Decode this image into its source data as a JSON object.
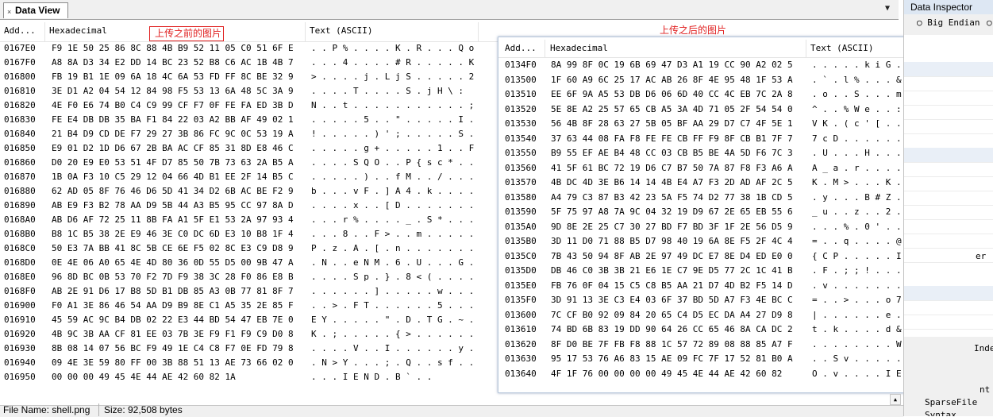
{
  "tab": {
    "label": "Data View",
    "close_glyph": "×"
  },
  "collapse_glyph": "▼",
  "columns": {
    "addr": "Add...",
    "hex": "Hexadecimal",
    "text": "Text (ASCII)"
  },
  "annotation_before": "上传之前的图片",
  "annotation_after": "上传之后的图片",
  "left_rows": [
    {
      "a": "0167E0",
      "h": "F9 1E 50 25 86 8C 88 4B B9 52 11 05 C0 51 6F E",
      "t": ". . P % . . . . K . R . . . Q o"
    },
    {
      "a": "0167F0",
      "h": "A8 8A D3 34 E2 DD 14 BC 23 52 B8 C6 AC 1B 4B 7",
      "t": ". . . 4 . . . . # R . . . . . K"
    },
    {
      "a": "016800",
      "h": "FB 19 B1 1E 09 6A 18 4C 6A 53 FD FF 8C BE 32 9",
      "t": "> . . . . j . L j S . . . . . 2"
    },
    {
      "a": "016810",
      "h": "3E D1 A2 04 54 12 84 98 F5 53 13 6A 48 5C 3A 9",
      "t": ". . . . T . . . . S . j H \\ :"
    },
    {
      "a": "016820",
      "h": "4E F0 E6 74 B0 C4 C9 99 CF F7 0F FE FA ED 3B D",
      "t": "N . . t . . . . . . . . . . . ;"
    },
    {
      "a": "016830",
      "h": "FE E4 DB DB 35 BA F1 84 22 03 A2 BB AF 49 02 1",
      "t": ". . . . . 5 . . \" . . . . . I ."
    },
    {
      "a": "016840",
      "h": "21 B4 D9 CD DE F7 29 27 3B 86 FC 9C 0C 53 19 A",
      "t": "! . . . . . ) ' ; . . . . . S ."
    },
    {
      "a": "016850",
      "h": "E9 01 D2 1D D6 67 2B BA AC CF 85 31 8D E8 46 C",
      "t": ". . . . . g + . . . . . 1 . . F"
    },
    {
      "a": "016860",
      "h": "D0 20 E9 E0 53 51 4F D7 85 50 7B 73 63 2A B5 A",
      "t": ". . . . S Q O . . P { s c * . ."
    },
    {
      "a": "016870",
      "h": "1B 0A F3 10 C5 29 12 04 66 4D B1 EE 2F 14 B5 C",
      "t": ". . . . . ) . . f M . . / . . ."
    },
    {
      "a": "016880",
      "h": "62 AD 05 8F 76 46 D6 5D 41 34 D2 6B AC BE F2 9",
      "t": "b . . . v F . ] A 4 . k . . . ."
    },
    {
      "a": "016890",
      "h": "AB E9 F3 B2 78 AA D9 5B 44 A3 B5 95 CC 97 8A D",
      "t": ". . . . x . . [ D . . . . . . ."
    },
    {
      "a": "0168A0",
      "h": "AB D6 AF 72 25 11 8B FA A1 5F E1 53 2A 97 93 4",
      "t": ". . . r % . . . . _ . S * . . ."
    },
    {
      "a": "0168B0",
      "h": "B8 1C B5 38 2E E9 46 3E C0 DC 6D E3 10 B8 1F 4",
      "t": ". . . 8 . . F > . . m . . . . ."
    },
    {
      "a": "0168C0",
      "h": "50 E3 7A BB 41 8C 5B CE 6E F5 02 8C E3 C9 D8 9",
      "t": "P . z . A . [ . n . . . . . . ."
    },
    {
      "a": "0168D0",
      "h": "0E 4E 06 A0 65 4E 4D 80 36 0D 55 D5 00 9B 47 A",
      "t": ". N . . e N M . 6 . U . . . G ."
    },
    {
      "a": "0168E0",
      "h": "96 8D BC 0B 53 70 F2 7D F9 38 3C 28 F0 86 E8 B",
      "t": ". . . . S p . } . 8 < ( . . . ."
    },
    {
      "a": "0168F0",
      "h": "AB 2E 91 D6 17 B8 5D B1 DB 85 A3 0B 77 81 8F 7",
      "t": ". . . . . . ] . . . . . w . . ."
    },
    {
      "a": "016900",
      "h": "F0 A1 3E 86 46 54 AA D9 B9 8E C1 A5 35 2E 85 F",
      "t": ". . > . F T . . . . . . 5 . . ."
    },
    {
      "a": "016910",
      "h": "45 59 AC 9C B4 DB 02 22 E3 44 BD 54 47 EB 7E 0",
      "t": "E Y . . . . . \" . D . T G . ~ ."
    },
    {
      "a": "016920",
      "h": "4B 9C 3B AA CF 81 EE 03 7B 3E F9 F1 F9 C9 D0 8",
      "t": "K . ; . . . . . { > . . . . . ."
    },
    {
      "a": "016930",
      "h": "8B 08 14 07 56 BC F9 49 1E C4 C8 F7 0E FD 79 8",
      "t": ". . . . V . . I . . . . . . y ."
    },
    {
      "a": "016940",
      "h": "09 4E 3E 59 80 FF 00 3B 88 51 13 AE 73 66 02 0",
      "t": ". N > Y . . . ; . Q . . s f . ."
    },
    {
      "a": "016950",
      "h": "00 00 00 49 45 4E 44 AE 42 60 82 1A",
      "t": ". . . I E N D . B ` . ."
    }
  ],
  "right_rows": [
    {
      "a": "0134F0",
      "h": "8A 99 8F 0C 19 6B 69 47 D3 A1 19 CC 90 A2 02 5",
      "t": ". . . . . k i G . . . . . . . ."
    },
    {
      "a": "013500",
      "h": "1F 60 A9 6C 25 17 AC AB 26 8F 4E 95 48 1F 53 A",
      "t": ". ` . l % . . . & . N . H . S ."
    },
    {
      "a": "013510",
      "h": "EE 6F 9A A5 53 DB D6 06 6D 40 CC 4C EB 7C 2A 8",
      "t": ". o . . S . . . m @ . L . | * ."
    },
    {
      "a": "013520",
      "h": "5E 8E A2 25 57 65 CB A5 3A 4D 71 05 2F 54 54 0",
      "t": "^ . . % W e . . : M q . / T T ."
    },
    {
      "a": "013530",
      "h": "56 4B 8F 28 63 27 5B 05 BF AA 29 D7 C7 4F 5E 1",
      "t": "V K . ( c ' [ . . . ) . . O ^ ."
    },
    {
      "a": "013540",
      "h": "37 63 44 08 FA F8 FE FE CB FF F9 8F CB B1 7F 7",
      "t": "7 c D . . . . . . . . . . . . ."
    },
    {
      "a": "013550",
      "h": "B9 55 EF AE B4 48 CC 03 CB B5 BE 4A 5D F6 7C 3",
      "t": ". U . . . H . . . . . J ] . | ."
    },
    {
      "a": "013560",
      "h": "41 5F 61 BC 72 19 D6 C7 B7 50 7A 87 F8 F3 A6 A",
      "t": "A _ a . r . . . . P z . . . . ."
    },
    {
      "a": "013570",
      "h": "4B DC 4D 3E B6 14 14 4B E4 A7 F3 2D AD AF 2C 5",
      "t": "K . M > . . . K . . . - . . , ."
    },
    {
      "a": "013580",
      "h": "A4 79 C3 87 B3 42 23 5A F5 74 D2 77 38 1B CD 5",
      "t": ". y . . . B # Z . t . w 8 . . ."
    },
    {
      "a": "013590",
      "h": "5F 75 97 A8 7A 9C 04 32 19 D9 67 2E 65 EB 55 6",
      "t": "_ u . . z . . 2 . . g . e . U ."
    },
    {
      "a": "0135A0",
      "h": "9D 8E 2E 25 C7 30 27 BD F7 BD 3F 1F 2E 56 D5 9",
      "t": ". . . % . 0 ' . . . ? . . V . ."
    },
    {
      "a": "0135B0",
      "h": "3D 11 D0 71 88 B5 D7 98 40 19 6A 8E F5 2F 4C 4",
      "t": "= . . q . . . . @ . j . . / L ."
    },
    {
      "a": "0135C0",
      "h": "7B 43 50 94 8F AB 2E 97 49 DC E7 8E D4 ED E0 0",
      "t": "{ C P . . . . . I . . . . . . ."
    },
    {
      "a": "0135D0",
      "h": "DB 46 C0 3B 3B 21 E6 1E C7 9E D5 77 2C 1C 41 B",
      "t": ". F . ; ; ! . . . . . w , . A ."
    },
    {
      "a": "0135E0",
      "h": "FB 76 0F 04 15 C5 C8 B5 AA 21 D7 4D B2 F5 14 D",
      "t": ". v . . . . . . . ! . M . . . ."
    },
    {
      "a": "0135F0",
      "h": "3D 91 13 3E C3 E4 03 6F 37 BD 5D A7 F3 4E BC C",
      "t": "= . . > . . . o 7 . ] . . N . ."
    },
    {
      "a": "013600",
      "h": "7C CF B0 92 09 84 20 65 C4 D5 EC DA A4 27 D9 8",
      "t": "| . . . . . . e . . . . . ' . ."
    },
    {
      "a": "013610",
      "h": "74 BD 6B 83 19 DD 90 64 26 CC 65 46 8A CA DC 2",
      "t": "t . k . . . . d & . e F . . . ."
    },
    {
      "a": "013620",
      "h": "8F D0 BE 7F FB F8 88 1C 57 72 89 08 88 85 A7 F",
      "t": ". . . . . . . . W r . . . . . ."
    },
    {
      "a": "013630",
      "h": "95 17 53 76 A6 83 15 AE 09 FC 7F 17 52 81 B0 A",
      "t": ". . S v . . . . . . . . R . . ."
    },
    {
      "a": "013640",
      "h": "4F 1F 76 00 00 00 00 49 45 4E 44 AE 42 60 82",
      "t": "O . v . . . . I E N D . B ` ."
    }
  ],
  "statusbar": {
    "file_name": "File Name: shell.png",
    "size": "Size: 92,508 bytes"
  },
  "inspector": {
    "title": "Data Inspector",
    "big_endian": "Big Endian",
    "labels": {
      "er": "er",
      "index": "Index",
      "int": "nt",
      "sparse": "SparseFile",
      "syntax": "Syntax"
    }
  }
}
